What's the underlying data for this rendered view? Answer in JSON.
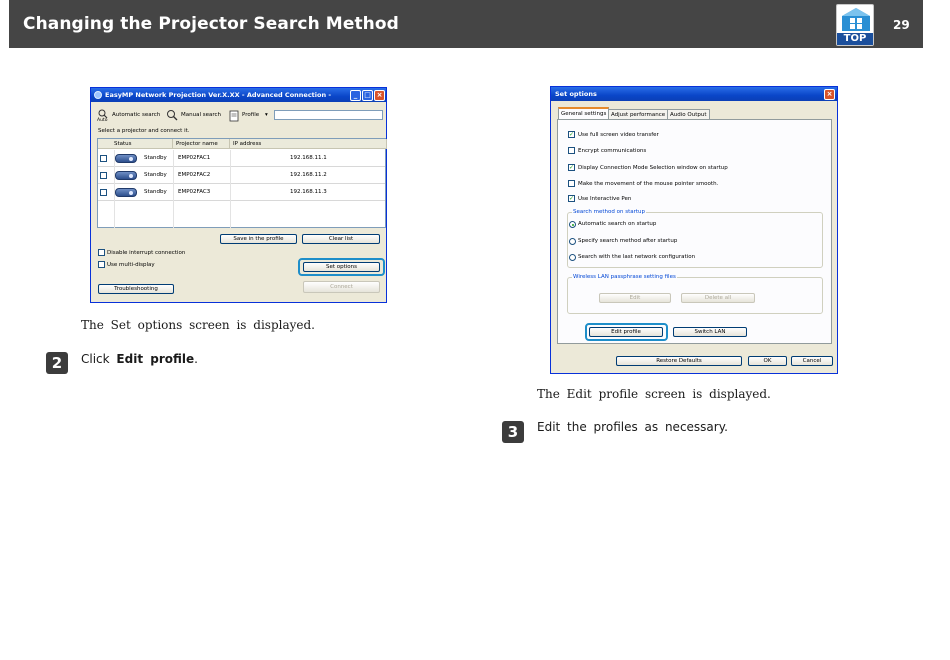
{
  "header": {
    "title": "Changing the Projector Search Method",
    "top_label": "TOP",
    "page_number": "29"
  },
  "left_window": {
    "title": "EasyMP Network Projection Ver.X.XX - Advanced Connection -",
    "toolbar": {
      "automatic_search": "Automatic search",
      "auto_icon_label": "Auto",
      "manual_search": "Manual search",
      "profile": "Profile"
    },
    "hint": "Select a projector and connect it.",
    "columns": [
      "Status",
      "Projector name",
      "IP address"
    ],
    "rows": [
      {
        "status": "Standby",
        "name": "EMP02FAC1",
        "ip": "192.168.11.1"
      },
      {
        "status": "Standby",
        "name": "EMP02FAC2",
        "ip": "192.168.11.2"
      },
      {
        "status": "Standby",
        "name": "EMP02FAC3",
        "ip": "192.168.11.3"
      }
    ],
    "save_profile": "Save in the profile",
    "clear_list": "Clear list",
    "disable_interrupt": "Disable interrupt connection",
    "use_multi_display": "Use multi-display",
    "set_options": "Set options",
    "troubleshooting": "Troubleshooting",
    "connect": "Connect"
  },
  "left_caption": "The Set options screen is displayed.",
  "step2": {
    "number": "2",
    "prefix": "Click",
    "bold": "Edit profile",
    "suffix": "."
  },
  "right_window": {
    "title": "Set options",
    "tabs": [
      "General settings",
      "Adjust performance",
      "Audio Output"
    ],
    "checks": [
      {
        "label": "Use full screen video transfer",
        "checked": true
      },
      {
        "label": "Encrypt communications",
        "checked": false
      },
      {
        "label": "Display Connection Mode Selection window on startup",
        "checked": true
      },
      {
        "label": "Make the movement of the mouse pointer smooth.",
        "checked": false
      },
      {
        "label": "Use Interactive Pen",
        "checked": true
      }
    ],
    "search_group": "Search method on startup",
    "radios": [
      {
        "label": "Automatic search on startup",
        "selected": true
      },
      {
        "label": "Specify search method after startup",
        "selected": false
      },
      {
        "label": "Search with the last network configuration",
        "selected": false
      }
    ],
    "wireless_group": "Wireless LAN passphrase setting files",
    "edit": "Edit",
    "delete_all": "Delete all",
    "edit_profile": "Edit profile",
    "switch_lan": "Switch LAN",
    "restore_defaults": "Restore Defaults",
    "ok": "OK",
    "cancel": "Cancel"
  },
  "right_caption": "The Edit profile screen is displayed.",
  "step3": {
    "number": "3",
    "text": "Edit the profiles as necessary."
  },
  "colors": {
    "header_bg": "#454545",
    "highlight": "#1e8ec9",
    "xp_title": "#0a46c8"
  }
}
